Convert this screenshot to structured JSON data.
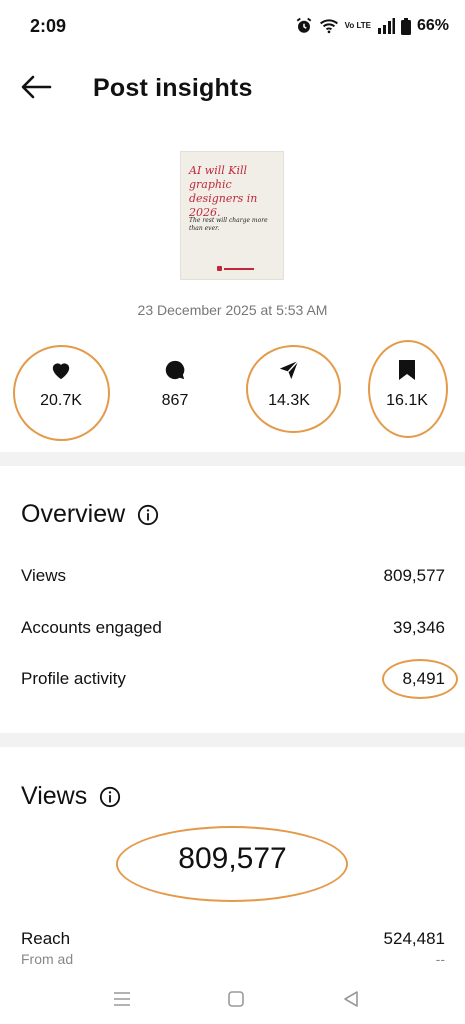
{
  "status_bar": {
    "time": "2:09",
    "volte": "Vo LTE",
    "battery": "66%"
  },
  "header": {
    "title": "Post insights",
    "back_icon": "arrow-left-icon"
  },
  "post": {
    "thumbnail": {
      "headline": "AI will Kill graphic designers in 2026.",
      "subtext": "The rest will charge more than ever."
    },
    "date": "23 December 2025 at 5:53 AM"
  },
  "metrics": {
    "likes": {
      "icon": "heart-icon",
      "value": "20.7K"
    },
    "comments": {
      "icon": "comment-icon",
      "value": "867"
    },
    "shares": {
      "icon": "send-icon",
      "value": "14.3K"
    },
    "saves": {
      "icon": "bookmark-icon",
      "value": "16.1K"
    }
  },
  "overview": {
    "title": "Overview",
    "rows": [
      {
        "label": "Views",
        "value": "809,577"
      },
      {
        "label": "Accounts engaged",
        "value": "39,346"
      },
      {
        "label": "Profile activity",
        "value": "8,491"
      }
    ]
  },
  "views": {
    "title": "Views",
    "total": "809,577",
    "reach_label": "Reach",
    "reach_value": "524,481",
    "from_ad_label": "From ad",
    "from_ad_value": "--"
  },
  "colors": {
    "annotation_ring": "#e49a48",
    "thumbnail_accent": "#c0283a",
    "divider": "#f2f2f2"
  }
}
